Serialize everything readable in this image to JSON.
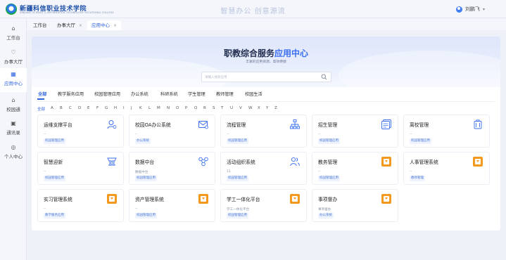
{
  "header": {
    "school_name": "新疆科信职业技术学院",
    "school_name_en": "XINJIANG SCIENCE & INFORMATION TECHNOLOGY VOCATIONAL COLLEGE",
    "slogan": "智慧办公 创意源流",
    "user_name": "刘鹏飞",
    "caret": "▾"
  },
  "sidebar": {
    "items": [
      {
        "label": "工作台",
        "icon": "home-icon",
        "glyph": "⌂"
      },
      {
        "label": "办事大厅",
        "icon": "service-icon",
        "glyph": "♡"
      },
      {
        "label": "应用中心",
        "icon": "apps-icon",
        "glyph": "▦"
      },
      {
        "label": "校园通",
        "icon": "campus-icon",
        "glyph": "⌂"
      },
      {
        "label": "通讯录",
        "icon": "contacts-icon",
        "glyph": "▣"
      },
      {
        "label": "个人中心",
        "icon": "user-icon",
        "glyph": "◎"
      }
    ]
  },
  "tabs": [
    {
      "label": "工作台",
      "closable": false
    },
    {
      "label": "办事大厅",
      "closable": true
    },
    {
      "label": "应用中心",
      "closable": true
    }
  ],
  "tab_close_glyph": "×",
  "banner": {
    "title_prefix": "职教综合服务",
    "title_highlight": "应用中心",
    "subtitle": "丰富的应用资源，高效便捷",
    "search_placeholder": "请输入搜索应用"
  },
  "categories": [
    "全部",
    "教学服务应用",
    "校园管理应用",
    "办公系统",
    "科研系统",
    "学生管理",
    "教师管理",
    "校园生活"
  ],
  "letters": [
    "全部",
    "A",
    "B",
    "C",
    "D",
    "E",
    "F",
    "G",
    "H",
    "I",
    "J",
    "K",
    "L",
    "M",
    "N",
    "O",
    "P",
    "Q",
    "R",
    "S",
    "T",
    "U",
    "V",
    "W",
    "X",
    "Y",
    "Z"
  ],
  "cards": [
    {
      "title": "运维支撑平台",
      "desc": "--",
      "tag": "校园管理应用",
      "icon": "monitor-user-icon"
    },
    {
      "title": "校园OA办公系统",
      "desc": "--",
      "tag": "办公系统",
      "icon": "mail-settings-icon"
    },
    {
      "title": "流程管理",
      "desc": "--",
      "tag": "校园管理应用",
      "icon": "flow-chart-icon"
    },
    {
      "title": "招生管理",
      "desc": "--",
      "tag": "校园管理应用",
      "icon": "document-stack-icon"
    },
    {
      "title": "离校管理",
      "desc": "--",
      "tag": "校园管理应用",
      "icon": "luggage-icon"
    },
    {
      "title": "智慧迎新",
      "desc": "--",
      "tag": "校园管理应用",
      "icon": "welcome-icon"
    },
    {
      "title": "数据中台",
      "desc": "数据中台",
      "tag": "校园管理应用",
      "icon": "data-hub-icon"
    },
    {
      "title": "活动组织系统",
      "desc": "11",
      "tag": "校园管理应用",
      "icon": "people-icon"
    },
    {
      "title": "教务管理",
      "desc": "--",
      "tag": "校园管理应用",
      "icon": "app-badge-icon"
    },
    {
      "title": "人事管理系统",
      "desc": "--",
      "tag": "教师管理",
      "icon": "app-badge-icon"
    },
    {
      "title": "实习管理系统",
      "desc": "--",
      "tag": "教学服务应用",
      "icon": "app-badge-icon"
    },
    {
      "title": "资产管理系统",
      "desc": "--",
      "tag": "校园管理应用",
      "icon": "app-badge-icon"
    },
    {
      "title": "学工一体化平台",
      "desc": "学工一体化平台",
      "tag": "校园管理应用",
      "icon": "app-badge-icon"
    },
    {
      "title": "事项督办",
      "desc": "事项督办",
      "tag": "办公系统",
      "icon": "app-badge-icon"
    }
  ]
}
